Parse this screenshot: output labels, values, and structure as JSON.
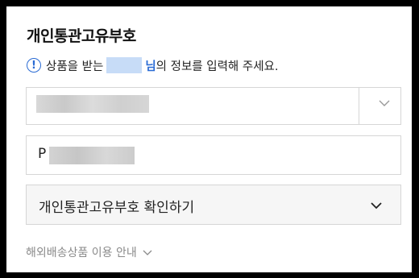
{
  "header": {
    "title": "개인통관고유부호"
  },
  "notice": {
    "icon": "info-icon",
    "prefix": "상품을 받는",
    "name_suffix": "님",
    "suffix": "의 정보를 입력해 주세요."
  },
  "recipient_select": {
    "icon": "chevron-down-icon"
  },
  "customs_input": {
    "value_prefix": "P"
  },
  "confirm_accordion": {
    "label": "개인통관고유부호 확인하기",
    "icon": "chevron-down-icon"
  },
  "footer": {
    "link_label": "해외배송상품 이용 안내",
    "icon": "chevron-down-icon"
  },
  "colors": {
    "accent": "#2a6bd4",
    "border": "#d6d6d6",
    "muted": "#8a8a8a"
  }
}
